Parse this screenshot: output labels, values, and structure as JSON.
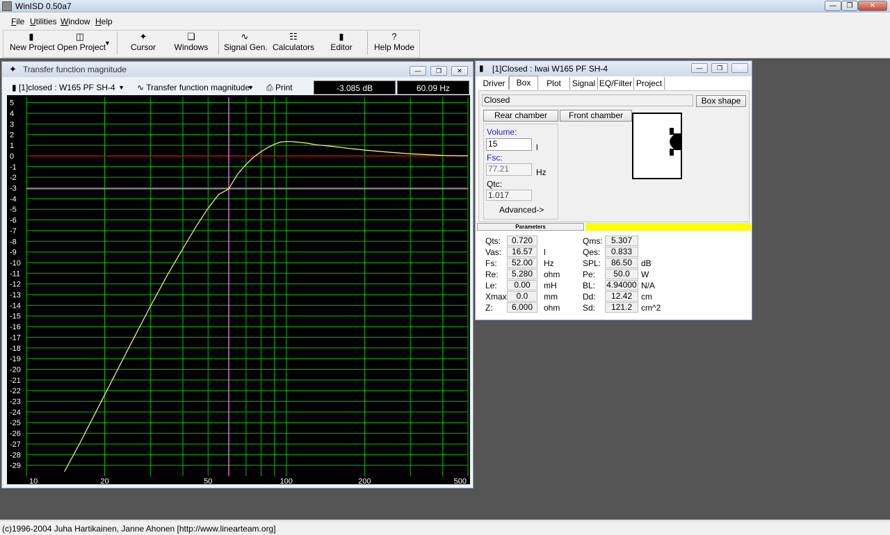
{
  "window": {
    "title": "WinISD 0.50a7"
  },
  "menu": [
    {
      "label": "File",
      "key": "F",
      "rest": "ile"
    },
    {
      "label": "Utilities",
      "key": "U",
      "rest": "tilities"
    },
    {
      "label": "Window",
      "key": "W",
      "rest": "indow"
    },
    {
      "label": "Help",
      "key": "H",
      "rest": "elp"
    }
  ],
  "toolbar": {
    "new_project": "New Project",
    "open_project": "Open Project",
    "cursor": "Cursor",
    "windows": "Windows",
    "signal_gen": "Signal Gen.",
    "calculators": "Calculators",
    "editor": "Editor",
    "help_mode": "Help Mode"
  },
  "graph_window": {
    "title": "Transfer function magnitude",
    "project_select": "[1]closed : W165 PF SH-4",
    "graph_select": "Transfer function magnitude",
    "print": "Print",
    "cursor_db": "-3.085 dB",
    "cursor_hz": "60.09 Hz"
  },
  "chart_data": {
    "type": "line",
    "xscale": "log",
    "xlim": [
      10,
      500
    ],
    "ylim": [
      -30,
      5.5
    ],
    "xticks": [
      10,
      20,
      50,
      100,
      200,
      500
    ],
    "yticks": [
      5,
      4,
      3,
      2,
      1,
      0,
      -1,
      -2,
      -3,
      -4,
      -5,
      -6,
      -7,
      -8,
      -9,
      -10,
      -11,
      -12,
      -13,
      -14,
      -15,
      -16,
      -17,
      -18,
      -19,
      -20,
      -21,
      -22,
      -23,
      -24,
      -25,
      -26,
      -27,
      -28,
      -29
    ],
    "grid": true,
    "reference_line_db": 0,
    "cursor": {
      "x": 60.09,
      "y": -3.085
    },
    "series": [
      {
        "x": [
          14,
          16,
          20,
          25,
          30,
          35,
          40,
          45,
          50,
          55,
          60,
          65,
          70,
          75,
          80,
          85,
          90,
          95,
          100,
          105,
          110,
          120,
          130,
          150,
          175,
          200,
          250,
          300,
          400,
          500
        ],
        "y": [
          -29.6,
          -27.0,
          -22.4,
          -17.8,
          -14.1,
          -11.1,
          -8.7,
          -6.6,
          -4.9,
          -3.6,
          -3.1,
          -1.7,
          -0.8,
          -0.1,
          0.4,
          0.8,
          1.1,
          1.3,
          1.35,
          1.35,
          1.3,
          1.2,
          1.05,
          0.9,
          0.7,
          0.55,
          0.35,
          0.2,
          0.05,
          0.0
        ]
      }
    ],
    "colors": {
      "background": "#000000",
      "grid": "#00c000",
      "curve": "#ffff80",
      "zero": "#ff0000",
      "cursor": "#ff80ff"
    }
  },
  "box_window": {
    "title": "[1]Closed : Iwai W165 PF SH-4",
    "tabs": [
      "Driver",
      "Box",
      "Plot",
      "Signal",
      "EQ/Filter",
      "Project"
    ],
    "active_tab": "Box",
    "box_type": "Closed",
    "box_shape_button": "Box shape",
    "rear_chamber": "Rear chamber",
    "front_chamber": "Front chamber",
    "volume_label": "Volume:",
    "volume_value": "15",
    "volume_unit": "l",
    "fsc_label": "Fsc:",
    "fsc_value": "77.21",
    "fsc_unit": "Hz",
    "qtc_label": "Qtc:",
    "qtc_value": "1.017",
    "advanced": "Advanced->",
    "parameters_header": "Parameters"
  },
  "params": {
    "left": [
      {
        "label": "Qts:",
        "value": "0.720",
        "unit": ""
      },
      {
        "label": "Vas:",
        "value": "16.57",
        "unit": "l"
      },
      {
        "label": "Fs:",
        "value": "52.00",
        "unit": "Hz"
      },
      {
        "label": "Re:",
        "value": "5.280",
        "unit": "ohm"
      },
      {
        "label": "Le:",
        "value": "0.00",
        "unit": "mH"
      },
      {
        "label": "Xmax:",
        "value": "0.0",
        "unit": "mm"
      },
      {
        "label": "Z:",
        "value": "6.000",
        "unit": "ohm"
      }
    ],
    "right": [
      {
        "label": "Qms:",
        "value": "5.307",
        "unit": ""
      },
      {
        "label": "Qes:",
        "value": "0.833",
        "unit": ""
      },
      {
        "label": "SPL:",
        "value": "86.50",
        "unit": "dB"
      },
      {
        "label": "Pe:",
        "value": "50.0",
        "unit": "W"
      },
      {
        "label": "BL:",
        "value": "4.94000",
        "unit": "N/A"
      },
      {
        "label": "Dd:",
        "value": "12.42",
        "unit": "cm"
      },
      {
        "label": "Sd:",
        "value": "121.2",
        "unit": "cm^2"
      }
    ]
  },
  "status": {
    "text": "(c)1996-2004 Juha Hartikainen, Janne Ahonen [http://www.linearteam.org]"
  }
}
